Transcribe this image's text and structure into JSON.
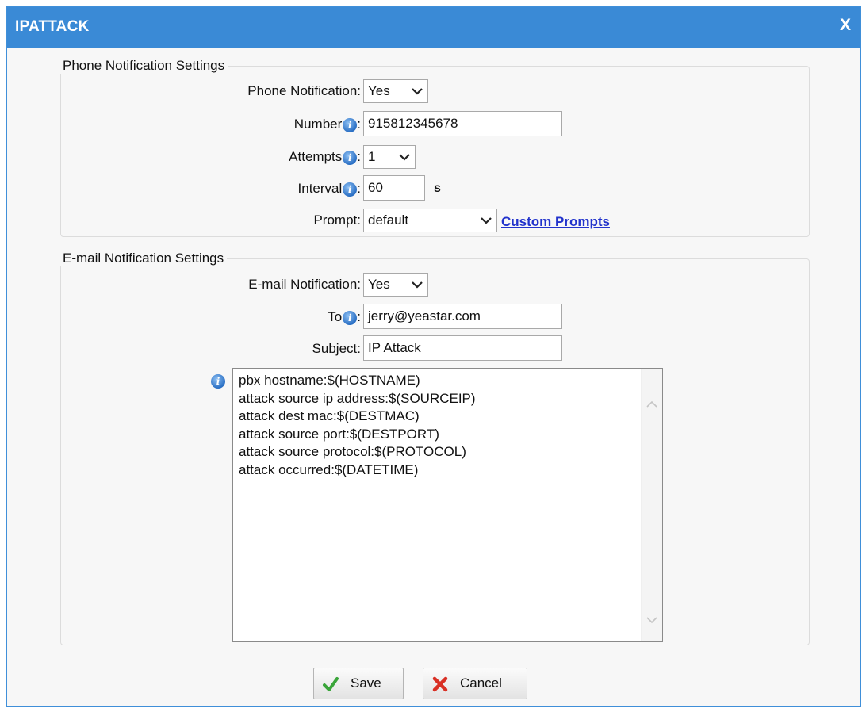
{
  "dialog": {
    "title": "IPATTACK",
    "close_label": "X"
  },
  "phone_section": {
    "legend": "Phone Notification Settings",
    "phone_notification": {
      "label": "Phone Notification:",
      "value": "Yes"
    },
    "number": {
      "label": "Number",
      "value": "915812345678"
    },
    "attempts": {
      "label": "Attempts",
      "value": "1"
    },
    "interval": {
      "label": "Interval",
      "value": "60",
      "unit": "s"
    },
    "prompt": {
      "label": "Prompt:",
      "value": "default",
      "link": "Custom Prompts"
    }
  },
  "email_section": {
    "legend": "E-mail Notification Settings",
    "email_notification": {
      "label": "E-mail Notification:",
      "value": "Yes"
    },
    "to": {
      "label": "To",
      "value": "jerry@yeastar.com"
    },
    "subject": {
      "label": "Subject:",
      "value": "IP Attack"
    },
    "body_lines": [
      "pbx hostname:$(HOSTNAME)",
      "attack source ip address:$(SOURCEIP)",
      "attack dest mac:$(DESTMAC)",
      "attack source port:$(DESTPORT)",
      "attack source protocol:$(PROTOCOL)",
      "attack occurred:$(DATETIME)"
    ]
  },
  "buttons": {
    "save": "Save",
    "cancel": "Cancel"
  },
  "icons": {
    "info": "info-icon",
    "chevron": "chevron-down-icon",
    "save": "check-icon",
    "cancel": "x-icon"
  },
  "colors": {
    "titlebar": "#3a8ad6",
    "link": "#2233cc"
  }
}
